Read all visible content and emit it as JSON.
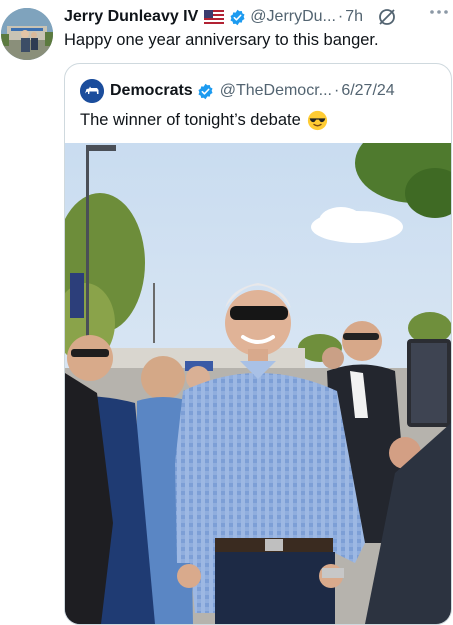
{
  "post": {
    "author_name": "Jerry Dunleavy IV",
    "handle": "@JerryDu...",
    "separator": "·",
    "time": "7h",
    "text": "Happy one year anniversary to this banger.",
    "icons": {
      "avatar": "profile-photo",
      "flag": "us-flag-icon",
      "verified": "verified-badge-icon",
      "grok": "grok-icon",
      "more": "more-options-icon"
    }
  },
  "quote": {
    "author_name": "Democrats",
    "handle": "@TheDemocr...",
    "separator": "·",
    "date": "6/27/24",
    "text": "The winner of tonight’s debate",
    "emoji": "sunglasses-emoji",
    "logo": "democrats-donkey-logo",
    "photo_alt": "man in blue checkered shirt and aviator sunglasses smiling among a crowd outdoors"
  },
  "colors": {
    "text": "#0f1419",
    "secondary": "#536471",
    "verified": "#1d9bf0",
    "border": "#cfd9de",
    "dem_blue": "#1b4d9c"
  }
}
